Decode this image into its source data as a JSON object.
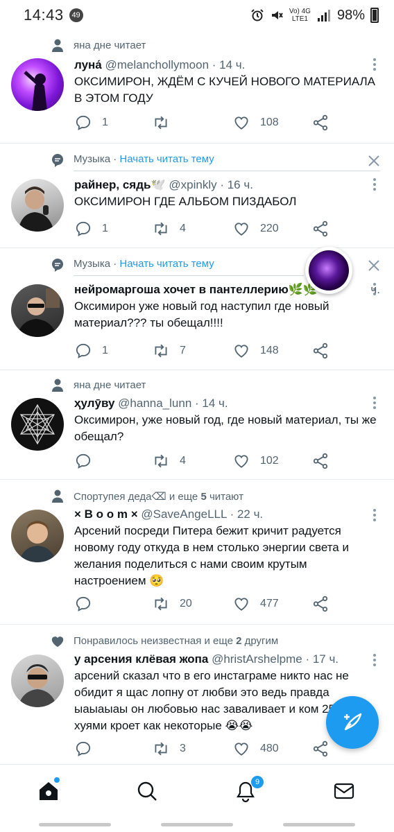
{
  "status_bar": {
    "time": "14:43",
    "notif_count": "49",
    "network": "Vo) 4G",
    "network_sub": "LTE1",
    "battery": "98%"
  },
  "tweets": [
    {
      "context": "яна дне читает",
      "name": "луна́",
      "handle": "@melanchollymoon",
      "time": "· 14 ч.",
      "text": "ОКСИМИРОН, ЖДЁМ С КУЧЕЙ НОВОГО МАТЕРИАЛА В ЭТОМ ГОДУ",
      "replies": "1",
      "retweets": "",
      "likes": "108"
    },
    {
      "topic": "Музыка",
      "topic_sep": "·",
      "topic_action": "Начать читать тему",
      "name": "райнер, сядь🕊️",
      "handle": "@xpinkly",
      "time": "· 16 ч.",
      "text": "ОКСИМИРОН ГДЕ АЛЬБОМ ПИЗДАБОЛ",
      "replies": "1",
      "retweets": "4",
      "likes": "220"
    },
    {
      "topic": "Музыка",
      "topic_sep": "·",
      "topic_action": "Начать читать тему",
      "name": "нейромаргоша хочет в пантеллерию🌿🌿",
      "handle": "",
      "time": "ч.",
      "text": "Оксимирон уже новый год наступил где новый материал??? ты обещал!!!!",
      "replies": "1",
      "retweets": "7",
      "likes": "148"
    },
    {
      "context": "яна дне читает",
      "name": "ҳулӯву",
      "handle": "@hanna_lunn",
      "time": "· 14 ч.",
      "text": "Оксимирон, уже новый год, где новый материал, ты же обещал?",
      "replies": "",
      "retweets": "4",
      "likes": "102"
    },
    {
      "context_prefix": "Спортупея деда⌫",
      "context_suffix": " и еще ",
      "context_num": "5",
      "context_end": " читают",
      "name": "× B o o m ×",
      "handle": "@SaveAngeLLL",
      "time": "· 22 ч.",
      "text": "Арсений посреди Питера бежит кричит радуется новому году откуда в нем столько энергии света и желания поделиться с нами своим крутым настроением 🥺",
      "replies": "",
      "retweets": "20",
      "likes": "477"
    },
    {
      "context_prefix": "Понравилось неизвестная",
      "context_suffix": " и еще ",
      "context_num": "2",
      "context_end": " другим",
      "name": "у арсения клёвая жопа",
      "handle": "@hristArshelpme",
      "time": "· 17 ч.",
      "text": "арсений сказал что в его инстаграме никто нас не обидит я щас лопну от любви это ведь правда ыаыаыаы он любовью нас заваливает и ком 25/8 а не хуями кроет как некоторые 😭😭",
      "replies": "",
      "retweets": "3",
      "likes": "480"
    }
  ],
  "tab_bar": {
    "notifications_badge": "9"
  },
  "icons": {
    "accent": "#1d9bf0",
    "muted": "#536471"
  }
}
